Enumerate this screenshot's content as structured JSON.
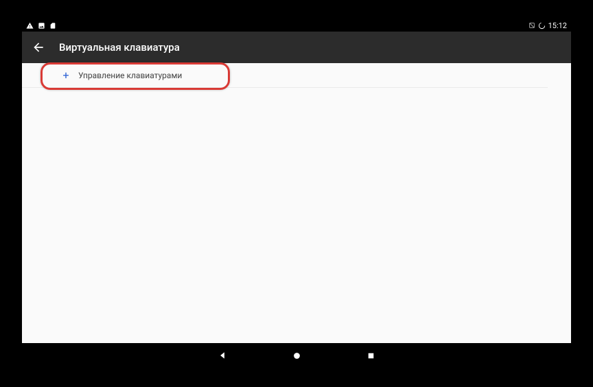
{
  "status": {
    "time": "15:12"
  },
  "header": {
    "title": "Виртуальная клавиатура"
  },
  "content": {
    "manage_keyboards_label": "Управление клавиатурами"
  }
}
